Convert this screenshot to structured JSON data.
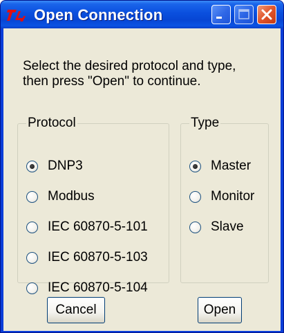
{
  "window": {
    "title": "Open Connection",
    "icon": "app-logo-icon",
    "title_buttons": [
      "minimize-icon",
      "maximize-icon",
      "close-icon"
    ]
  },
  "instructions": {
    "line1": "Select the desired protocol and type,",
    "line2": "then press \"Open\" to continue."
  },
  "protocol_group": {
    "label": "Protocol",
    "options": [
      {
        "label": "DNP3",
        "checked": true
      },
      {
        "label": "Modbus",
        "checked": false
      },
      {
        "label": "IEC 60870-5-101",
        "checked": false
      },
      {
        "label": "IEC 60870-5-103",
        "checked": false
      },
      {
        "label": "IEC 60870-5-104",
        "checked": false
      }
    ]
  },
  "type_group": {
    "label": "Type",
    "options": [
      {
        "label": "Master",
        "checked": true
      },
      {
        "label": "Monitor",
        "checked": false
      },
      {
        "label": "Slave",
        "checked": false
      }
    ]
  },
  "buttons": {
    "cancel_label": "Cancel",
    "open_label": "Open"
  },
  "colors": {
    "titlebar": "#0a4fde",
    "client_bg": "#ece9d8",
    "close_button": "#e0552b"
  }
}
